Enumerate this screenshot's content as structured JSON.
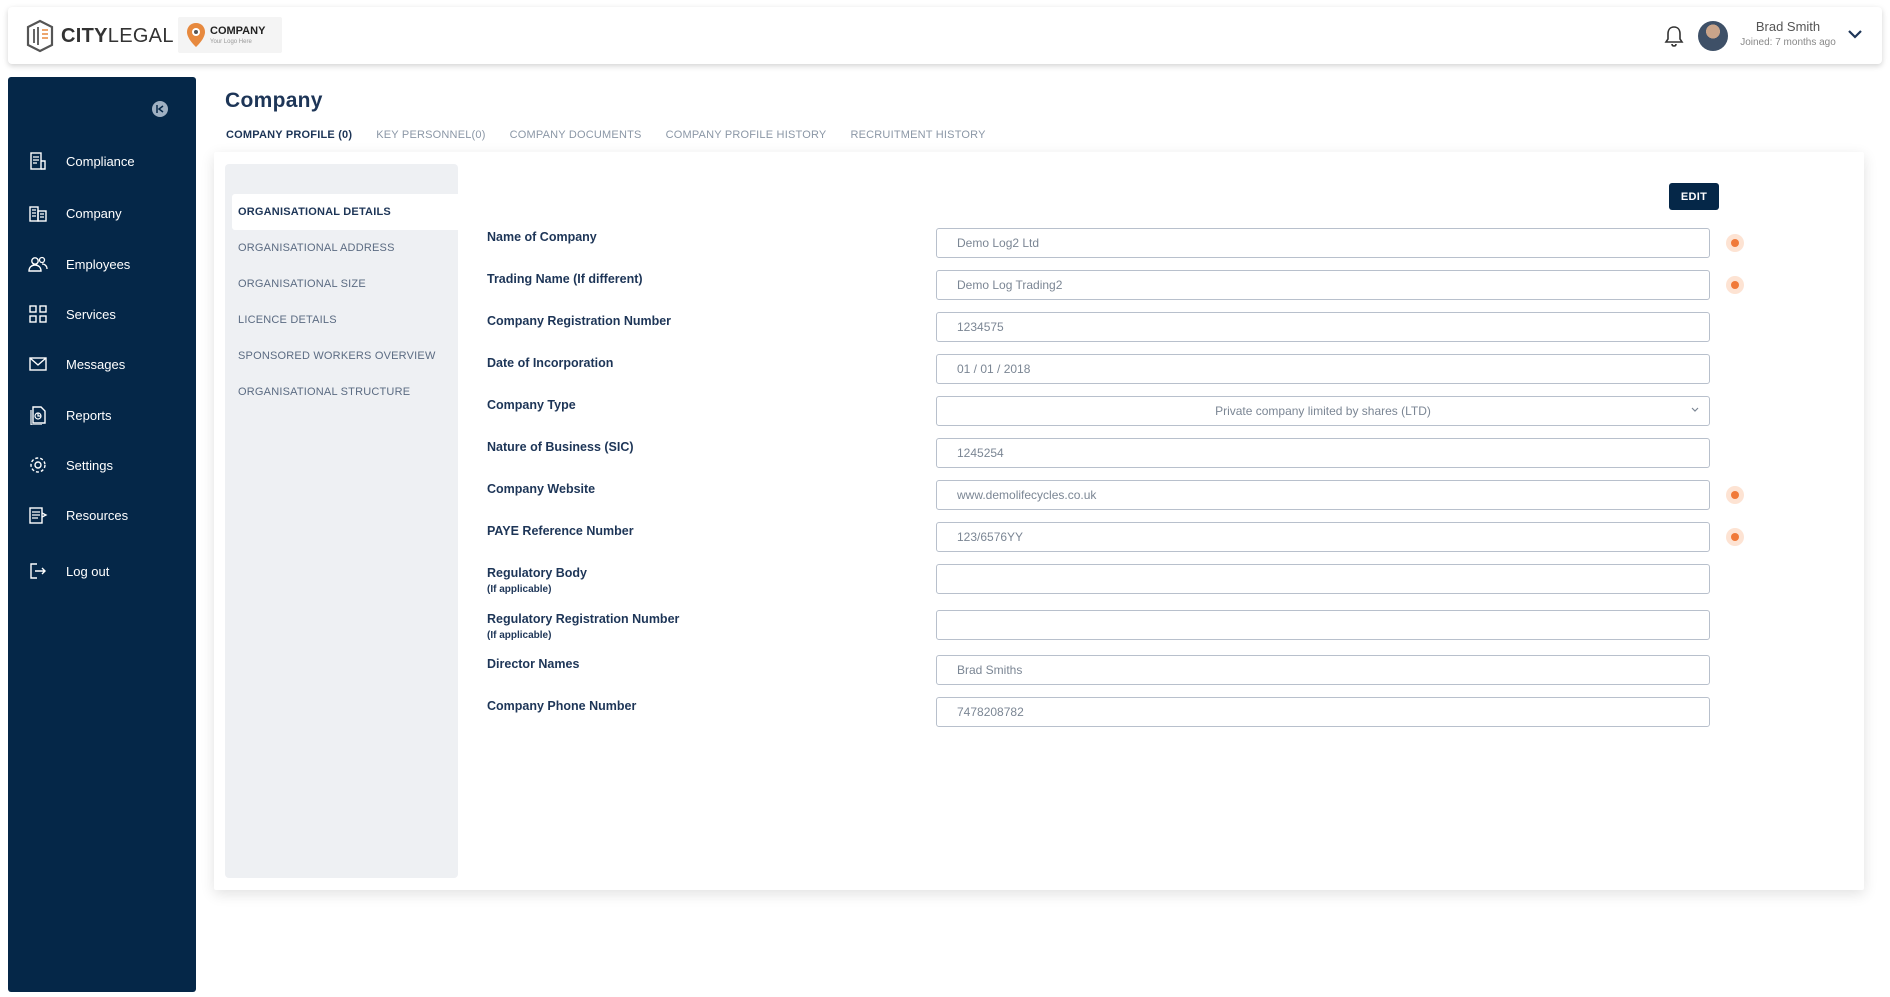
{
  "header": {
    "brand_bold": "CITY",
    "brand_light": "LEGAL",
    "company_logo_title": "COMPANY",
    "company_logo_sub": "Your Logo Here",
    "user_name": "Brad Smith",
    "user_joined": "Joined: 7 months ago"
  },
  "sidebar": {
    "items": [
      {
        "label": "Compliance",
        "icon": "compliance-icon"
      },
      {
        "label": "Company",
        "icon": "building-icon"
      },
      {
        "label": "Employees",
        "icon": "users-icon"
      },
      {
        "label": "Services",
        "icon": "grid-icon"
      },
      {
        "label": "Messages",
        "icon": "envelope-icon"
      },
      {
        "label": "Reports",
        "icon": "report-icon"
      },
      {
        "label": "Settings",
        "icon": "gear-icon"
      },
      {
        "label": "Resources",
        "icon": "resources-icon"
      },
      {
        "label": "Log out",
        "icon": "logout-icon"
      }
    ]
  },
  "page": {
    "title": "Company",
    "tabs": [
      {
        "label": "COMPANY PROFILE (0)",
        "active": true
      },
      {
        "label": "KEY PERSONNEL(0)",
        "active": false
      },
      {
        "label": "COMPANY DOCUMENTS",
        "active": false
      },
      {
        "label": "COMPANY PROFILE HISTORY",
        "active": false
      },
      {
        "label": "RECRUITMENT HISTORY",
        "active": false
      }
    ],
    "subnav": [
      {
        "label": "ORGANISATIONAL DETAILS",
        "active": true
      },
      {
        "label": "ORGANISATIONAL ADDRESS",
        "active": false
      },
      {
        "label": "ORGANISATIONAL SIZE",
        "active": false
      },
      {
        "label": "LICENCE DETAILS",
        "active": false
      },
      {
        "label": "SPONSORED WORKERS OVERVIEW",
        "active": false
      },
      {
        "label": "ORGANISATIONAL STRUCTURE",
        "active": false
      }
    ],
    "edit_label": "EDIT"
  },
  "form": {
    "fields": [
      {
        "label": "Name of Company",
        "sub": "",
        "value": "Demo Log2 Ltd",
        "flag": true
      },
      {
        "label": "Trading Name (If different)",
        "sub": "",
        "value": "Demo Log Trading2",
        "flag": true
      },
      {
        "label": "Company Registration Number",
        "sub": "",
        "value": "1234575",
        "flag": false
      },
      {
        "label": "Date of Incorporation",
        "sub": "",
        "value": "01 / 01 / 2018",
        "flag": false
      },
      {
        "label": "Company Type",
        "sub": "",
        "value": "Private company limited by shares (LTD)",
        "flag": false,
        "select": true
      },
      {
        "label": "Nature of Business (SIC)",
        "sub": "",
        "value": "1245254",
        "flag": false
      },
      {
        "label": "Company Website",
        "sub": "",
        "value": "www.demolifecycles.co.uk",
        "flag": true
      },
      {
        "label": "PAYE Reference Number",
        "sub": "",
        "value": "123/6576YY",
        "flag": true
      },
      {
        "label": "Regulatory Body",
        "sub": "(If applicable)",
        "value": "",
        "flag": false
      },
      {
        "label": "Regulatory Registration Number",
        "sub": "(If applicable)",
        "value": "",
        "flag": false
      },
      {
        "label": "Director Names",
        "sub": "",
        "value": "Brad Smiths",
        "flag": false
      },
      {
        "label": "Company Phone Number",
        "sub": "",
        "value": "7478208782",
        "flag": false
      }
    ]
  },
  "colors": {
    "navy": "#052748",
    "accent_orange": "#f07a3a"
  }
}
